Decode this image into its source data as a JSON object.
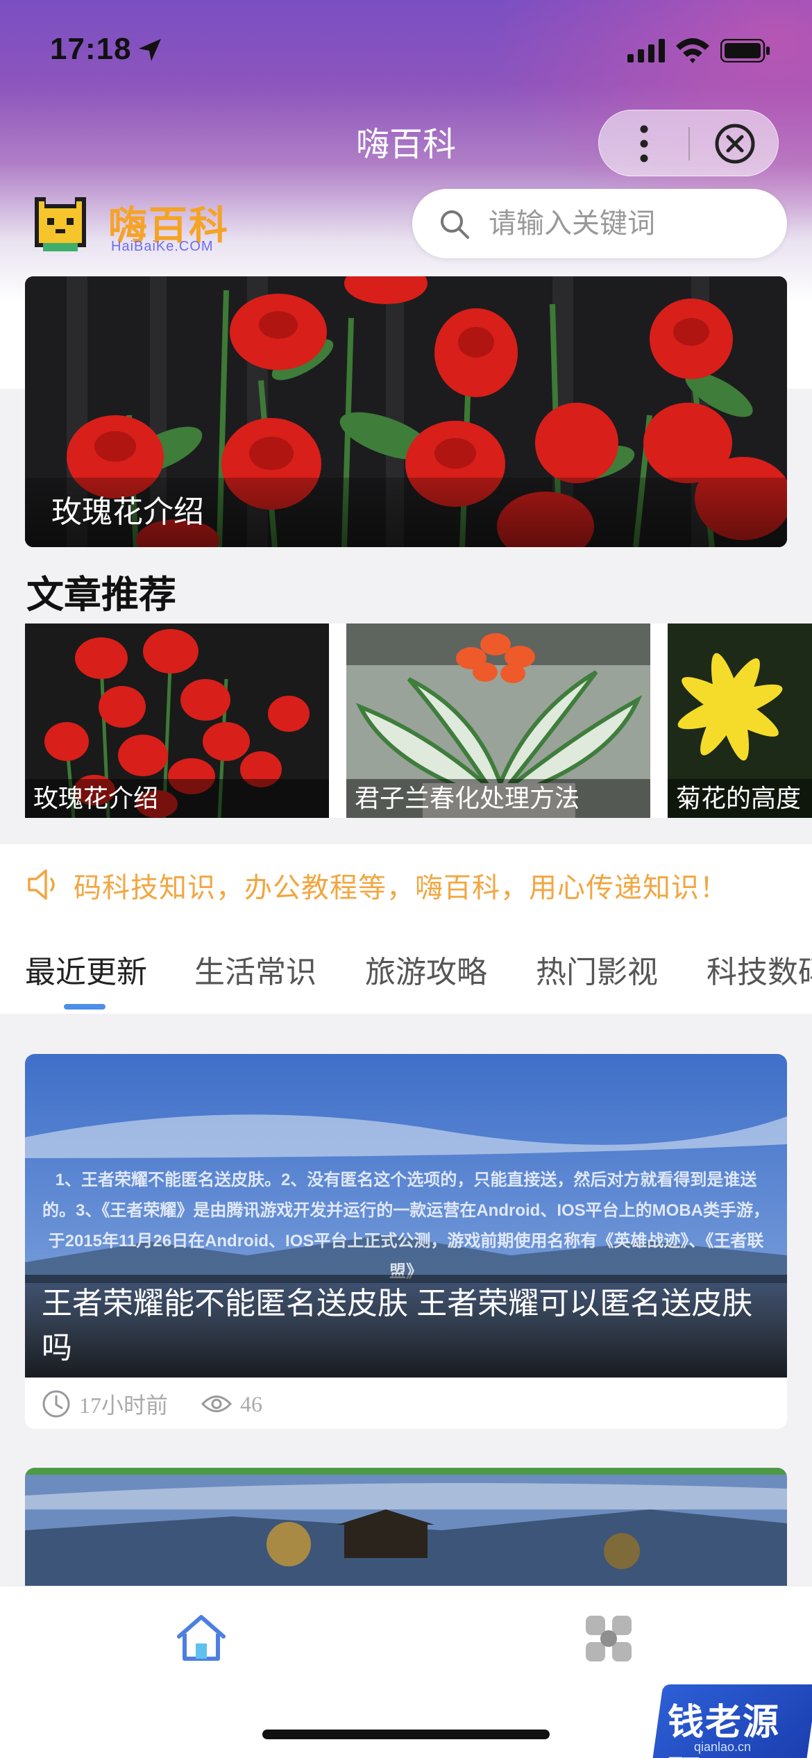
{
  "status_bar": {
    "time": "17:18"
  },
  "nav": {
    "title": "嗨百科"
  },
  "logo": {
    "text": "嗨百科",
    "sub": "HaiBaiKe.COM"
  },
  "search": {
    "placeholder": "请输入关键词",
    "value": ""
  },
  "hero": {
    "caption": "玫瑰花介绍"
  },
  "recommend": {
    "title": "文章推荐",
    "items": [
      {
        "label": "玫瑰花介绍"
      },
      {
        "label": "君子兰春化处理方法"
      },
      {
        "label": "菊花的高度"
      }
    ]
  },
  "notice": {
    "text": "码科技知识，办公教程等，嗨百科，用心传递知识！"
  },
  "tabs": [
    {
      "label": "最近更新",
      "active": true
    },
    {
      "label": "生活常识"
    },
    {
      "label": "旅游攻略"
    },
    {
      "label": "热门影视"
    },
    {
      "label": "科技数码"
    }
  ],
  "articles": [
    {
      "image_text": "1、王者荣耀不能匿名送皮肤。2、没有匿名这个选项的，只能直接送，然后对方就看得到是谁送的。3、《王者荣耀》是由腾讯游戏开发并运行的一款运营在Android、IOS平台上的MOBA类手游，于2015年11月26日在Android、IOS平台上正式公测，游戏前期使用名称有《英雄战迹》、《王者联盟》",
      "title": "王者荣耀能不能匿名送皮肤 王者荣耀可以匿名送皮肤吗",
      "time": "17小时前",
      "views": "46"
    }
  ],
  "watermark": {
    "text": "钱老源码",
    "sub": "qianlao.cn"
  },
  "colors": {
    "accent": "#4d8ee8",
    "notice": "#f2a640",
    "logo": "#f5a327"
  }
}
